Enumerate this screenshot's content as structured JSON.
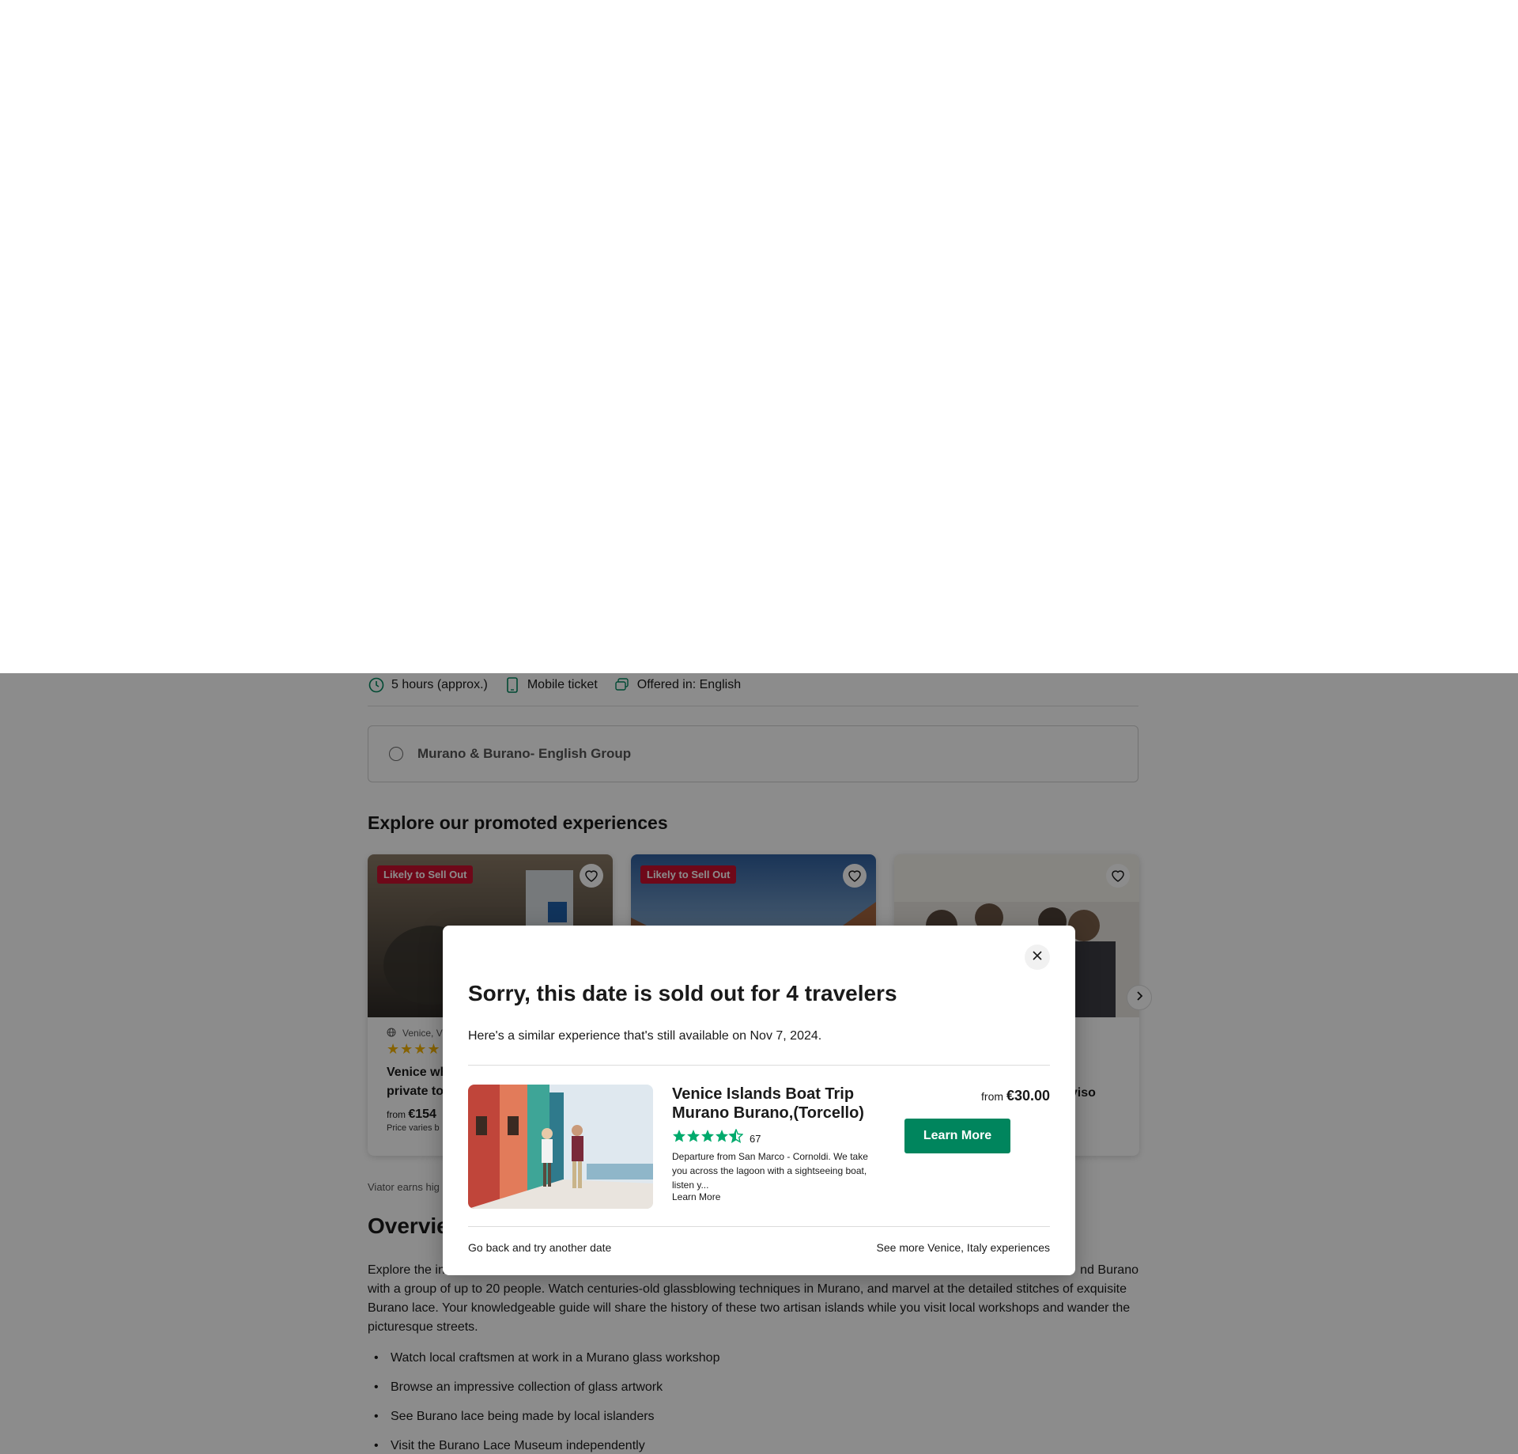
{
  "meta": {
    "duration": "5 hours (approx.)",
    "ticket": "Mobile ticket",
    "language": "Offered in: English"
  },
  "option": {
    "label": "Murano & Burano- English Group"
  },
  "promoted": {
    "title": "Explore our promoted experiences",
    "cards": [
      {
        "badge": "Likely to Sell Out",
        "location": "Venice, V",
        "stars": "★★★★",
        "title": "Venice wh\nprivate to",
        "price_from": "from",
        "price": "€154",
        "note": "Price varies b"
      },
      {
        "badge": "Likely to Sell Out",
        "location": "",
        "stars": "",
        "title": "",
        "price_from": "",
        "price": "",
        "note": ""
      },
      {
        "badge": "",
        "location": "",
        "stars": "",
        "title": "3\neviso",
        "price_from": "",
        "price": "",
        "note": ""
      }
    ]
  },
  "small_note": "Viator earns hig",
  "overview": {
    "title": "Overvie",
    "text_left": "Explore the in",
    "text_right": "nd Burano",
    "text_rest": "with a group of up to 20 people. Watch centuries-old glassblowing techniques in Murano, and marvel at the detailed stitches of exquisite Burano lace. Your knowledgeable guide will share the history of these two artisan islands while you visit local workshops and wander the picturesque streets.",
    "highlights": [
      "Watch local craftsmen at work in a Murano glass workshop",
      "Browse an impressive collection of glass artwork",
      "See Burano lace being made by local islanders",
      "Visit the Burano Lace Museum independently"
    ]
  },
  "modal": {
    "title": "Sorry, this date is sold out for 4 travelers",
    "subtitle": "Here's a similar experience that's still available on Nov 7, 2024.",
    "product": {
      "title": "Venice Islands Boat Trip Murano Burano,(Torcello)",
      "rating_count": "67",
      "description": "Departure from San Marco - Cornoldi. We take you across the lagoon with a sightseeing boat, listen y...",
      "more": "Learn More",
      "price_from": "from",
      "price": "€30.00",
      "button": "Learn More"
    },
    "go_back": "Go back and try another date",
    "see_more": "See more Venice, Italy experiences"
  },
  "colors": {
    "brand_green": "#00855d",
    "rating_green": "#00aa6c",
    "badge_red": "#c8102e"
  }
}
